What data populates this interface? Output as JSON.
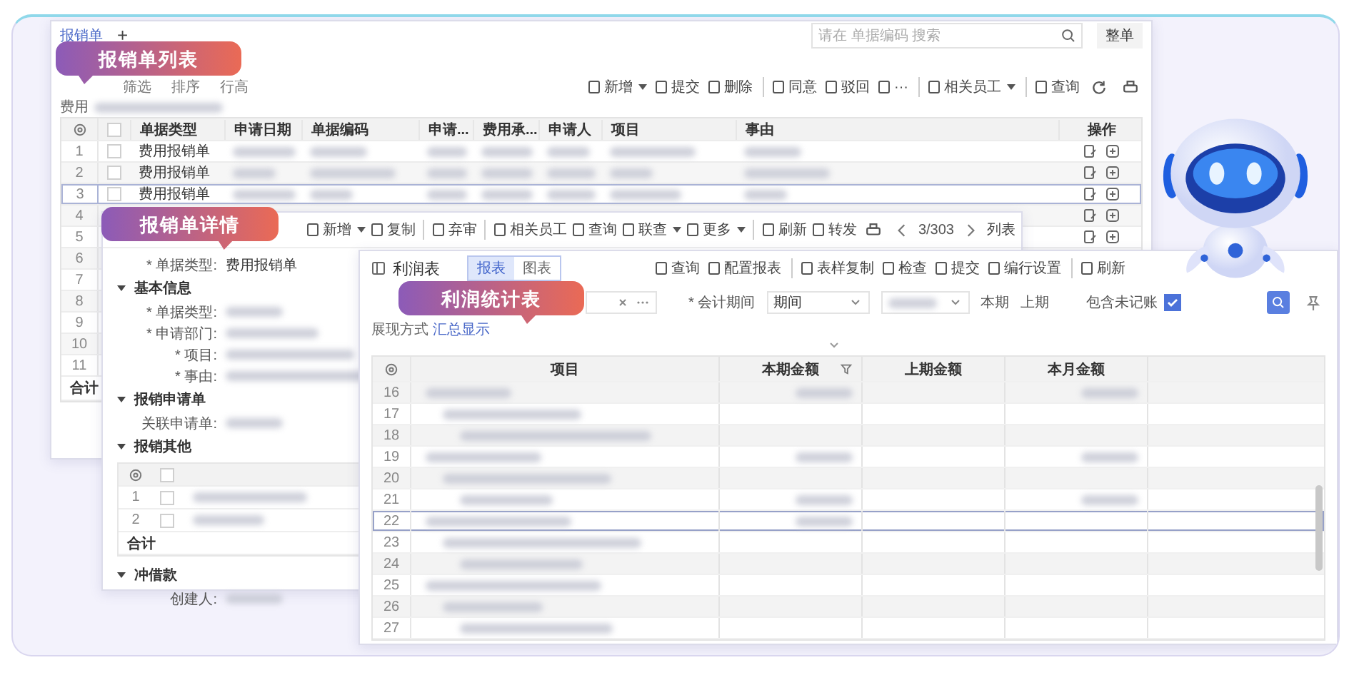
{
  "list_window": {
    "callout": "报销单列表",
    "tab": "报销单",
    "add_tab": "+",
    "search": {
      "placeholder": "请在 单据编码 搜索"
    },
    "view_menu": "整单",
    "left_tools": [
      "筛选",
      "排序",
      "行高"
    ],
    "toolbar": [
      {
        "label": "新增",
        "dropdown": true,
        "divider": false
      },
      {
        "label": "提交",
        "dropdown": false,
        "divider": false
      },
      {
        "label": "删除",
        "dropdown": false,
        "divider": false
      },
      {
        "label": "同意",
        "dropdown": false,
        "divider": true
      },
      {
        "label": "驳回",
        "dropdown": false,
        "divider": false
      },
      {
        "label": "···",
        "dropdown": false,
        "divider": false
      },
      {
        "label": "相关员工",
        "dropdown": true,
        "divider": true
      },
      {
        "label": "查询",
        "dropdown": false,
        "divider": true
      }
    ],
    "breadcrumb": "费用",
    "table": {
      "columns": [
        "单据类型",
        "申请日期",
        "单据编码",
        "申请...",
        "费用承...",
        "申请人",
        "项目",
        "事由",
        "操作"
      ],
      "all_checked": false,
      "rows": [
        {
          "no": "1",
          "type": "费用报销单",
          "checked": false,
          "selected": false
        },
        {
          "no": "2",
          "type": "费用报销单",
          "checked": false,
          "selected": false
        },
        {
          "no": "3",
          "type": "费用报销单",
          "checked": false,
          "selected": true
        },
        {
          "no": "4",
          "selected": false
        },
        {
          "no": "5",
          "selected": false
        },
        {
          "no": "6",
          "selected": false
        },
        {
          "no": "7",
          "selected": false
        },
        {
          "no": "8",
          "selected": false
        },
        {
          "no": "9",
          "selected": false
        },
        {
          "no": "10",
          "selected": false
        },
        {
          "no": "11",
          "selected": false
        }
      ],
      "total": "合计"
    }
  },
  "detail_window": {
    "callout": "报销单详情",
    "toolbar": [
      {
        "label": "新增",
        "dropdown": true,
        "divider": false
      },
      {
        "label": "复制",
        "dropdown": false,
        "divider": false
      },
      {
        "label": "弃审",
        "dropdown": false,
        "divider": true
      },
      {
        "label": "相关员工",
        "dropdown": false,
        "divider": true
      },
      {
        "label": "查询",
        "dropdown": false,
        "divider": false
      },
      {
        "label": "联查",
        "dropdown": true,
        "divider": false
      },
      {
        "label": "更多",
        "dropdown": true,
        "divider": false
      },
      {
        "label": "刷新",
        "dropdown": false,
        "divider": true
      },
      {
        "label": "转发",
        "dropdown": false,
        "divider": false
      }
    ],
    "page": "3/303",
    "list_view": "列表",
    "header_field": {
      "label": "* 单据类型:",
      "value": "费用报销单"
    },
    "sections": [
      {
        "title": "基本信息",
        "expanded": true,
        "fields": [
          {
            "label": "* 单据类型:"
          },
          {
            "label": "* 申请部门:"
          },
          {
            "label": "* 项目:"
          },
          {
            "label": "* 事由:"
          }
        ]
      },
      {
        "title": "报销申请单",
        "expanded": true,
        "fields": [
          {
            "label": "关联申请单:"
          }
        ]
      },
      {
        "title": "报销其他",
        "expanded": true,
        "table": {
          "all_checked": false,
          "rows": [
            {
              "no": "1",
              "checked": false
            },
            {
              "no": "2",
              "checked": false
            }
          ],
          "total": "合计"
        }
      },
      {
        "title": "冲借款",
        "expanded": true,
        "fields": [
          {
            "label": "创建人:"
          }
        ]
      }
    ]
  },
  "report_window": {
    "callout": "利润统计表",
    "title": "利润表",
    "view_tabs": [
      {
        "label": "报表",
        "selected": true
      },
      {
        "label": "图表",
        "selected": false
      }
    ],
    "toolbar": [
      {
        "label": "查询",
        "divider": false
      },
      {
        "label": "配置报表",
        "divider": false
      },
      {
        "label": "表样复制",
        "divider": true
      },
      {
        "label": "检查",
        "divider": false
      },
      {
        "label": "提交",
        "divider": false
      },
      {
        "label": "编行设置",
        "divider": false
      },
      {
        "label": "刷新",
        "divider": true
      }
    ],
    "filters": {
      "period_label": "* 会计期间",
      "period_value": "期间",
      "current": "本期",
      "previous": "上期",
      "unposted_label": "包含未记账",
      "unposted_checked": true
    },
    "display_mode_label": "展现方式",
    "display_mode_value": "汇总显示",
    "table": {
      "columns": [
        "项目",
        "本期金额",
        "上期金额",
        "本月金额"
      ],
      "rows": [
        {
          "no": "16",
          "selected": false
        },
        {
          "no": "17",
          "selected": false
        },
        {
          "no": "18",
          "selected": false
        },
        {
          "no": "19",
          "selected": false
        },
        {
          "no": "20",
          "selected": false
        },
        {
          "no": "21",
          "selected": false
        },
        {
          "no": "22",
          "selected": true
        },
        {
          "no": "23",
          "selected": false
        },
        {
          "no": "24",
          "selected": false
        },
        {
          "no": "25",
          "selected": false
        },
        {
          "no": "26",
          "selected": false
        },
        {
          "no": "27",
          "selected": false
        }
      ]
    }
  }
}
